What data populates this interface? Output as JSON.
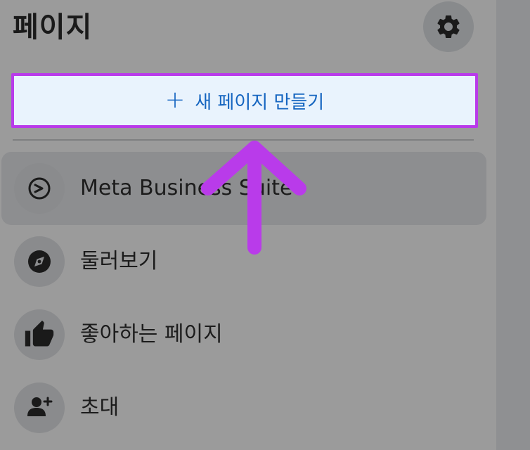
{
  "header": {
    "title": "페이지",
    "settings_icon": "gear-icon"
  },
  "create_button": {
    "icon": "+",
    "label": "새 페이지 만들기"
  },
  "menu": [
    {
      "label": "Meta Business Suite",
      "icon": "meta-business-suite-icon",
      "highlighted": true
    },
    {
      "label": "둘러보기",
      "icon": "compass-icon"
    },
    {
      "label": "좋아하는 페이지",
      "icon": "thumbs-up-icon"
    },
    {
      "label": "초대",
      "icon": "add-person-icon"
    }
  ],
  "colors": {
    "accent": "#1565c0",
    "highlight_border": "#b93bea",
    "annotation_arrow": "#b93bea"
  }
}
